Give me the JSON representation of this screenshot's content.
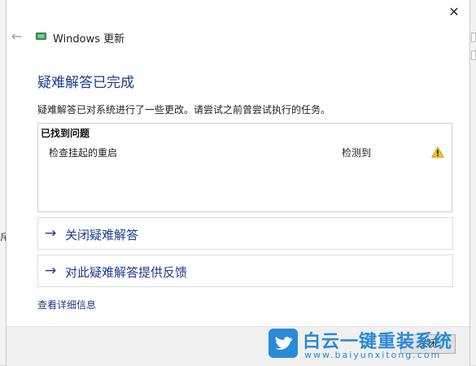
{
  "background": {
    "left_fragment_glyph": "斥"
  },
  "window": {
    "app_title": "Windows 更新",
    "close_glyph": "✕",
    "back_glyph": "←"
  },
  "content": {
    "heading": "疑难解答已完成",
    "description": "疑难解答已对系统进行了一些更改。请尝试之前曾尝试执行的任务。",
    "issues": {
      "header": "已找到问题",
      "rows": [
        {
          "name": "检查挂起的重启",
          "status": "检测到",
          "icon": "warning-icon"
        }
      ]
    },
    "actions": [
      {
        "arrow": "→",
        "label": "关闭疑难解答"
      },
      {
        "arrow": "→",
        "label": "对此疑难解答提供反馈"
      }
    ],
    "details_link": "查看详细信息"
  },
  "footer": {
    "close_label": "关闭"
  },
  "watermark": {
    "brand": "白云一键重装系统",
    "url": "www.baiyunxitong.com"
  },
  "colors": {
    "accent": "#1b3c8c",
    "warning": "#f0c419",
    "watermark": "#2a8ad8"
  }
}
